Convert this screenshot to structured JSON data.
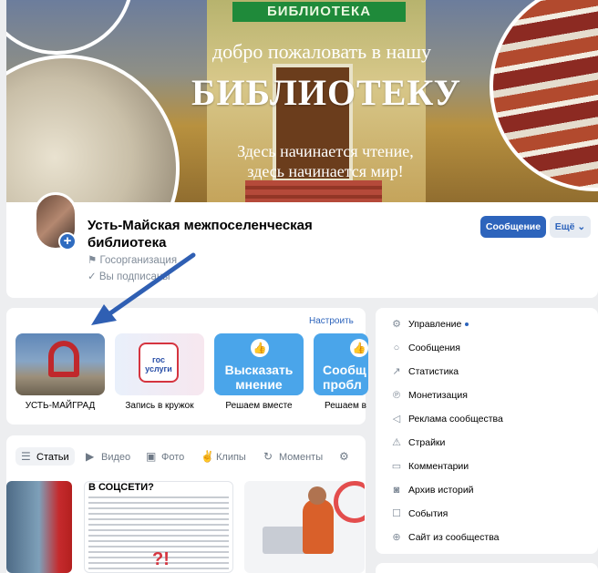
{
  "cover": {
    "sign": "БИБЛИОТЕКА",
    "welcome": "добро пожаловать в нашу",
    "headline": "БИБЛИОТЕКУ",
    "tagline1": "Здесь начинается чтение,",
    "tagline2": "здесь начинается мир!"
  },
  "profile": {
    "name": "Усть-Майская межпоселенческая библиотека",
    "type": "Госорганизация",
    "subscribed": "Вы подписаны",
    "message_button": "Сообщение",
    "more_button": "Ещё"
  },
  "apps": {
    "setup_link": "Настроить",
    "items": [
      {
        "label": "УСТЬ-МАЙГРАД"
      },
      {
        "label": "Запись в кружок",
        "logo_text": "гос услуги"
      },
      {
        "label": "Решаем вместе",
        "tile_text": "Высказать мнение"
      },
      {
        "label": "Решаем в",
        "tile_text": "Сообщ о пробл"
      }
    ]
  },
  "tabs": [
    {
      "label": "Статьи",
      "icon": "articles-icon"
    },
    {
      "label": "Видео",
      "icon": "video-icon"
    },
    {
      "label": "Фото",
      "icon": "photo-icon"
    },
    {
      "label": "Клипы",
      "icon": "clips-icon"
    },
    {
      "label": "Моменты",
      "icon": "moments-icon"
    }
  ],
  "posts": {
    "post2_heading": "В СОЦСЕТИ?"
  },
  "sidebar": {
    "items": [
      {
        "label": "Управление",
        "icon": "gear-icon"
      },
      {
        "label": "Сообщения",
        "icon": "chat-icon"
      },
      {
        "label": "Статистика",
        "icon": "chart-icon"
      },
      {
        "label": "Монетизация",
        "icon": "coin-icon"
      },
      {
        "label": "Реклама сообщества",
        "icon": "megaphone-icon"
      },
      {
        "label": "Страйки",
        "icon": "warning-icon"
      },
      {
        "label": "Комментарии",
        "icon": "comment-icon"
      },
      {
        "label": "Архив историй",
        "icon": "archive-icon"
      },
      {
        "label": "События",
        "icon": "calendar-icon"
      },
      {
        "label": "Сайт из сообщества",
        "icon": "globe-icon"
      }
    ]
  },
  "colors": {
    "accent": "#2d64bc",
    "arrow": "#2f5fb3",
    "background": "#edeef0"
  }
}
